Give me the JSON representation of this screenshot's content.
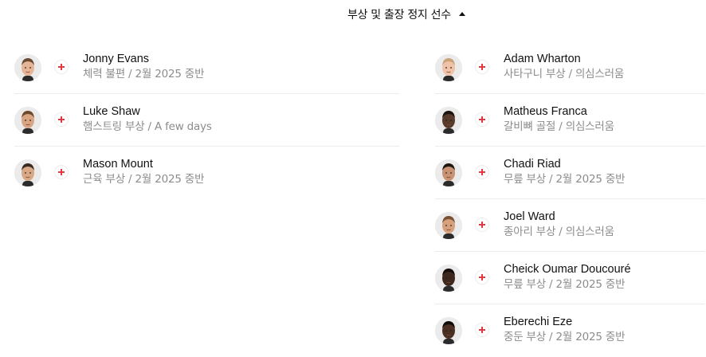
{
  "section": {
    "title": "부상 및 출장 정지 선수",
    "toggle_icon": "caret-up-icon"
  },
  "colors": {
    "injury_cross": "#e2383f",
    "status_text": "#8c8c8c",
    "divider": "#ececec"
  },
  "left_players": [
    {
      "name": "Jonny Evans",
      "status": "체력 불편 / 2월 2025 중반",
      "icon": "injury-cross-icon",
      "skin": "#e6b596",
      "hair": "#6b4a33"
    },
    {
      "name": "Luke Shaw",
      "status": "햄스트링 부상 / A few days",
      "icon": "injury-cross-icon",
      "skin": "#d9a583",
      "hair": "#6e4a2c"
    },
    {
      "name": "Mason Mount",
      "status": "근육 부상 / 2월 2025 중반",
      "icon": "injury-cross-icon",
      "skin": "#dba886",
      "hair": "#3b2a20"
    }
  ],
  "right_players": [
    {
      "name": "Adam Wharton",
      "status": "사타구니 부상 / 의심스러움",
      "icon": "injury-cross-icon",
      "skin": "#f0c3a8",
      "hair": "#c9a27a"
    },
    {
      "name": "Matheus Franca",
      "status": "갈비뼈 골절 / 의심스러움",
      "icon": "injury-cross-icon",
      "skin": "#5a3a2a",
      "hair": "#1d1410"
    },
    {
      "name": "Chadi Riad",
      "status": "무릎 부상 / 2월 2025 중반",
      "icon": "injury-cross-icon",
      "skin": "#c99272",
      "hair": "#1f1712"
    },
    {
      "name": "Joel Ward",
      "status": "종아리 부상 / 의심스러움",
      "icon": "injury-cross-icon",
      "skin": "#d7a07c",
      "hair": "#7a5233"
    },
    {
      "name": "Cheick Oumar Doucouré",
      "status": "무릎 부상 / 2월 2025 중반",
      "icon": "injury-cross-icon",
      "skin": "#3e271c",
      "hair": "#140d09"
    },
    {
      "name": "Eberechi Eze",
      "status": "중둔 부상 / 2월 2025 중반",
      "icon": "injury-cross-icon",
      "skin": "#4a2f22",
      "hair": "#120c09"
    }
  ]
}
